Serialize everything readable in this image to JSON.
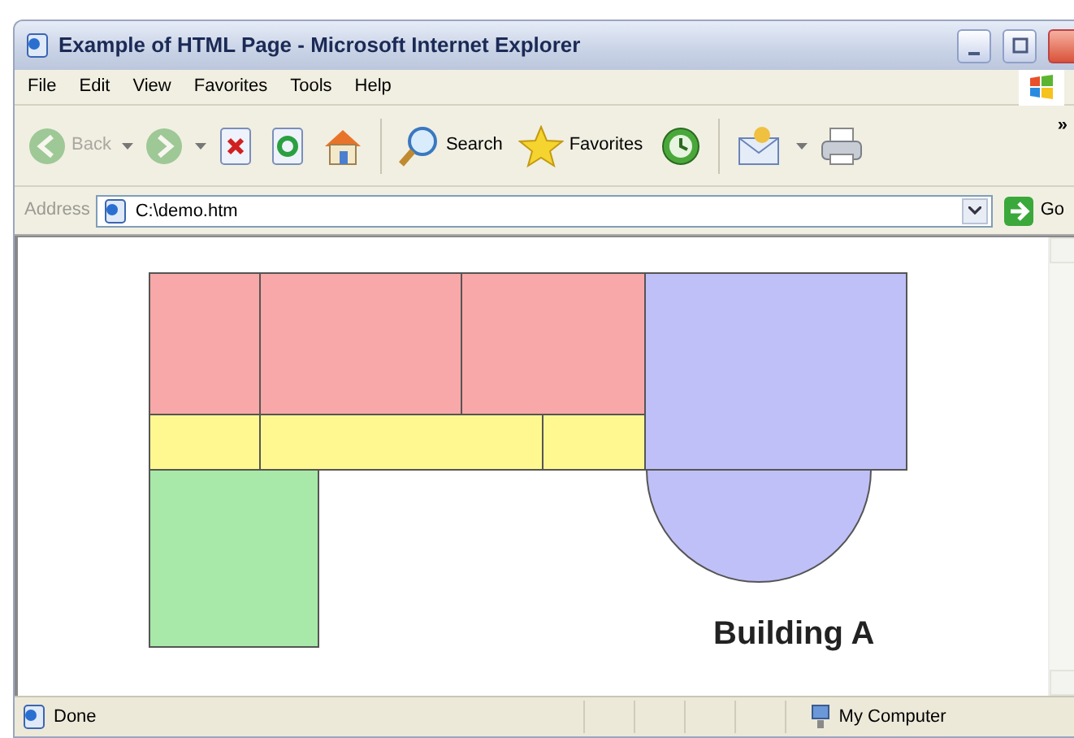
{
  "window": {
    "title": "Example of HTML Page - Microsoft Internet Explorer"
  },
  "menu": [
    "File",
    "Edit",
    "View",
    "Favorites",
    "Tools",
    "Help"
  ],
  "toolbar": [
    {
      "kind": "back",
      "label": "Back",
      "disabled": true
    },
    {
      "kind": "forward",
      "disabled": true
    },
    {
      "kind": "stop",
      "disabled": false
    },
    {
      "kind": "refresh",
      "disabled": false
    },
    {
      "kind": "home",
      "disabled": false
    },
    {
      "kind": "search",
      "label": "Search",
      "disabled": false
    },
    {
      "kind": "favorites",
      "label": "Favorites",
      "disabled": false
    },
    {
      "kind": "history",
      "disabled": false
    },
    {
      "kind": "mail",
      "disabled": false
    },
    {
      "kind": "print",
      "disabled": false
    }
  ],
  "toolbar_overflow": "»",
  "address": {
    "label": "Address",
    "value": "C:\\demo.htm",
    "go": "Go"
  },
  "page": {
    "rooms": [
      {
        "kind": "rect",
        "color": "#f8a8a8"
      },
      {
        "kind": "rect",
        "color": "#f8a8a8"
      },
      {
        "kind": "rect",
        "color": "#f8a8a8"
      },
      {
        "kind": "rect",
        "color": "#fff890"
      },
      {
        "kind": "rect",
        "color": "#fff890"
      },
      {
        "kind": "rect",
        "color": "#fff890"
      },
      {
        "kind": "rect",
        "color": "#a8e8a8"
      },
      {
        "kind": "half-circle",
        "color": "#c0c0f8"
      },
      {
        "kind": "rect",
        "color": "#c0c0f8"
      }
    ],
    "label": "Building A"
  },
  "status_bar": {
    "text": "Done",
    "zone": "My Computer"
  }
}
